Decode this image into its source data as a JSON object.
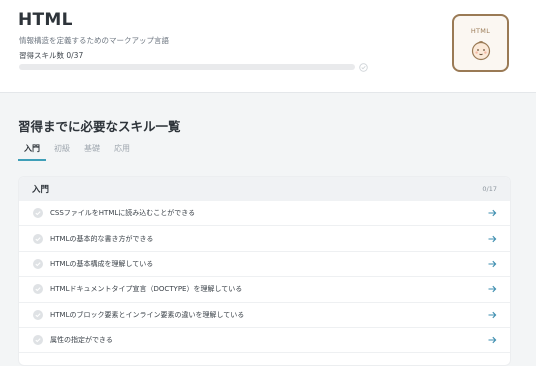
{
  "course": {
    "title": "HTML",
    "subtitle": "情報構造を定義するためのマークアップ言語",
    "progress_label": "習得スキル数 0/37",
    "progress_fraction": 0,
    "badge_text": "HTML"
  },
  "skills_section": {
    "title": "習得までに必要なスキル一覧",
    "tabs": [
      {
        "label": "入門",
        "active": true
      },
      {
        "label": "初級",
        "active": false
      },
      {
        "label": "基礎",
        "active": false
      },
      {
        "label": "応用",
        "active": false
      }
    ]
  },
  "level_card": {
    "title": "入門",
    "count": "0/17",
    "items": [
      {
        "label": "CSSファイルをHTMLに読み込むことができる"
      },
      {
        "label": "HTMLの基本的な書き方ができる"
      },
      {
        "label": "HTMLの基本構成を理解している"
      },
      {
        "label": "HTMLドキュメントタイプ宣言（DOCTYPE）を理解している"
      },
      {
        "label": "HTMLのブロック要素とインライン要素の違いを理解している"
      },
      {
        "label": "属性の指定ができる"
      }
    ]
  },
  "colors": {
    "accent": "#3f9fb8",
    "badge_border": "#9a7a55",
    "arrow": "#3f8fb0",
    "check": "#d8dcdf"
  },
  "icons": {
    "progress_check": "check-circle-icon",
    "item_check": "check-circle-icon",
    "item_arrow": "arrow-right-icon",
    "badge": "baby-face-icon"
  }
}
